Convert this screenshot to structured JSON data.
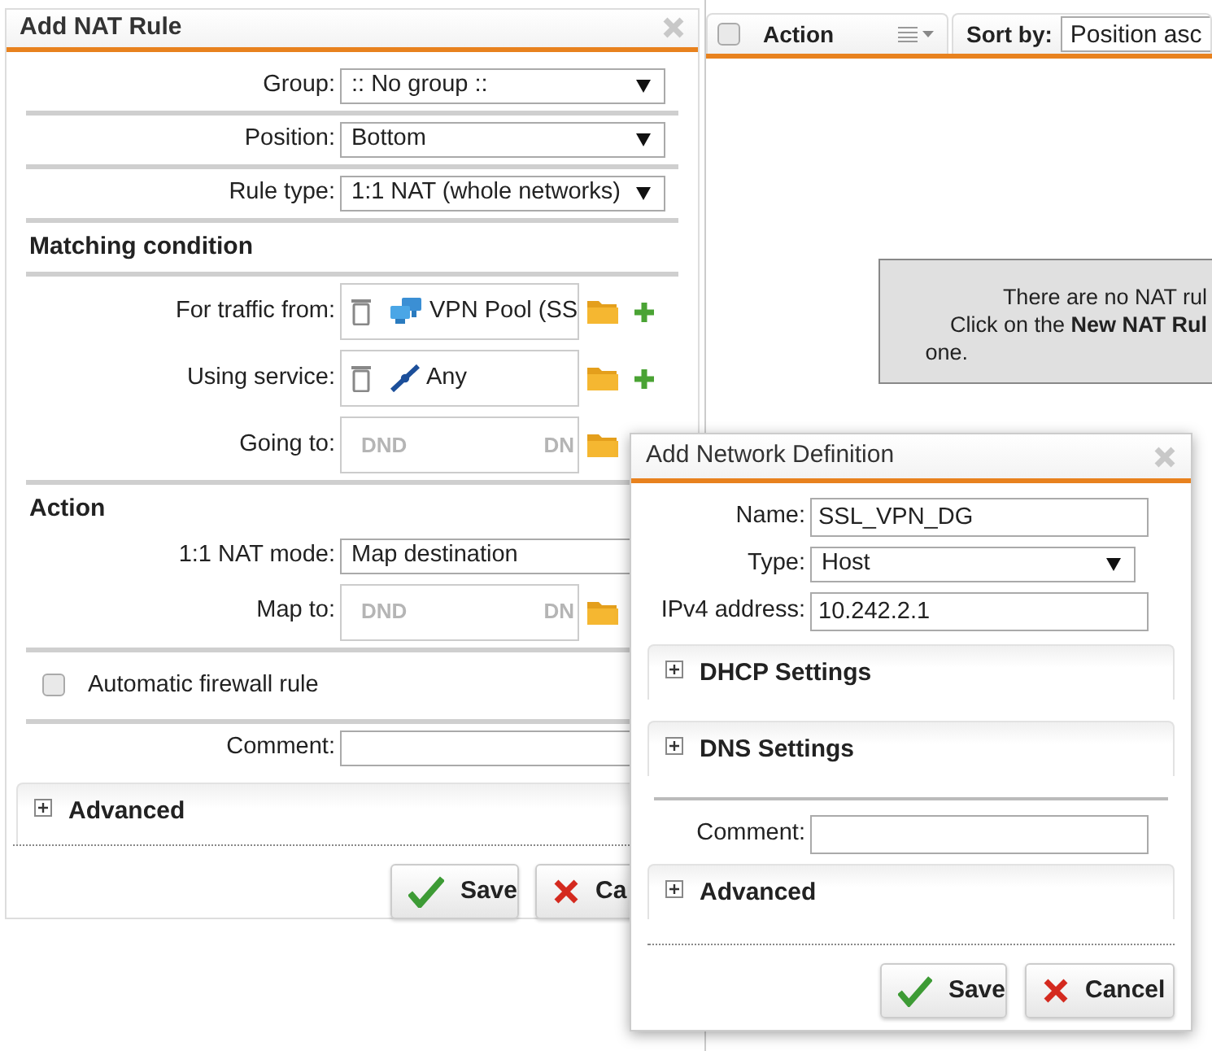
{
  "nat_rule_dialog": {
    "title": "Add NAT Rule",
    "groups": [
      [
        {
          "kind": "select",
          "label": "Group:",
          "value": ":: No group ::",
          "arrow": true
        }
      ],
      [
        {
          "kind": "select",
          "label": "Position:",
          "value": "Bottom",
          "arrow": true
        }
      ],
      [
        {
          "kind": "select",
          "label": "Rule type:",
          "value": "1:1 NAT (whole networks)",
          "arrow": true
        }
      ],
      [
        {
          "kind": "heading",
          "label": "Matching condition"
        }
      ],
      [
        {
          "kind": "chooser",
          "label": "For traffic from:",
          "item": {
            "text": "VPN Pool (SS"
          },
          "add": true
        },
        {
          "kind": "chooser",
          "label": "Using service:",
          "item": {
            "text": "Any"
          },
          "add": true
        },
        {
          "kind": "chooser",
          "label": "Going to:",
          "placeholders": [
            "DND",
            "DN"
          ],
          "add": false
        }
      ],
      [
        {
          "kind": "heading",
          "label": "Action"
        },
        {
          "kind": "select",
          "label": "1:1 NAT mode:",
          "value": "Map destination",
          "arrow": false
        },
        {
          "kind": "chooser",
          "label": "Map to:",
          "placeholders": [
            "DND",
            "DN"
          ],
          "add": false
        }
      ],
      [
        {
          "kind": "checkbox",
          "label": "Automatic firewall rule",
          "checked": false
        }
      ],
      [
        {
          "kind": "text",
          "label": "Comment:"
        }
      ]
    ],
    "panels": [
      {
        "title": "Advanced",
        "expanded": false
      }
    ],
    "buttons": [
      {
        "kind": "save",
        "label": "Save"
      },
      {
        "kind": "cancel",
        "label": "Ca"
      }
    ]
  },
  "rule_list": {
    "header": {
      "column": "Action",
      "checked": false,
      "sort_label": "Sort by:",
      "sort_value": "Position asc"
    },
    "empty_message": [
      "There are no NAT rul",
      "Click on the **New NAT Rul**",
      "one."
    ]
  },
  "network_dialog": {
    "title": "Add Network Definition",
    "fields": [
      {
        "kind": "text",
        "label": "Name:",
        "value": "SSL_VPN_DG"
      },
      {
        "kind": "select",
        "label": "Type:",
        "value": "Host"
      },
      {
        "kind": "text",
        "label": "IPv4 address:",
        "value": "10.242.2.1"
      }
    ],
    "panels": [
      {
        "title": "DHCP Settings",
        "expanded": false
      },
      {
        "title": "DNS Settings",
        "expanded": false
      }
    ],
    "comment": {
      "label": "Comment:"
    },
    "advanced": {
      "title": "Advanced",
      "expanded": false
    },
    "buttons": [
      {
        "kind": "save",
        "label": "Save"
      },
      {
        "kind": "cancel",
        "label": "Cancel"
      }
    ]
  }
}
